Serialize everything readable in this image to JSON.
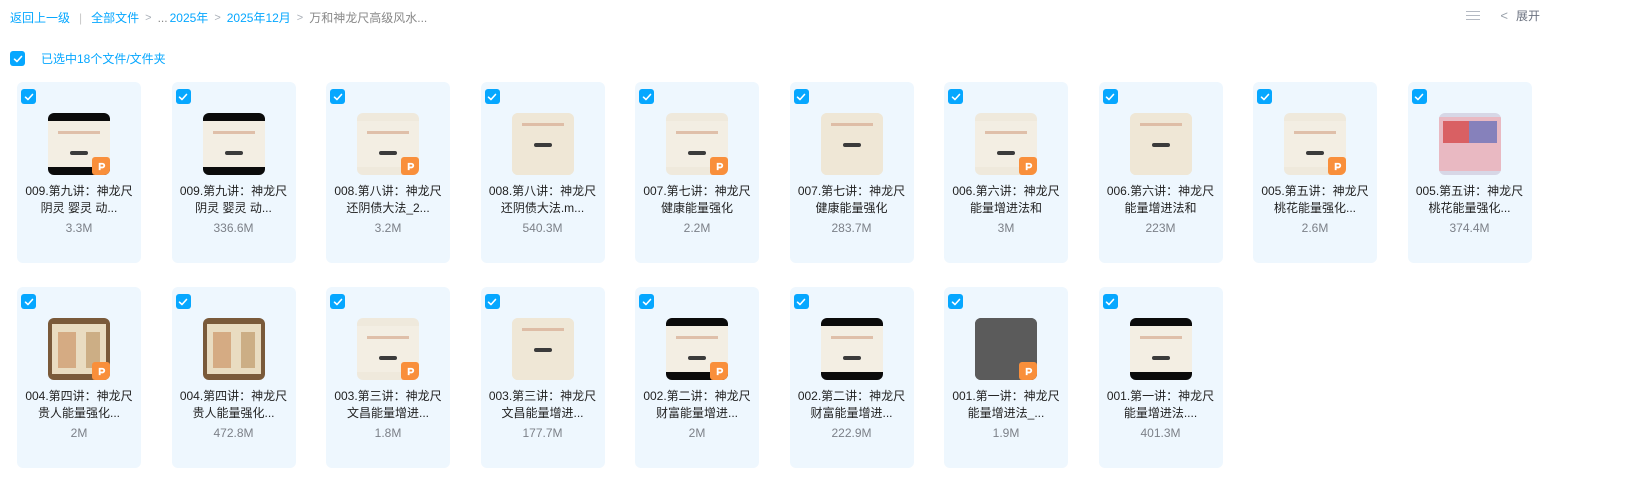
{
  "breadcrumb": {
    "back": "返回上一级",
    "separator": "|",
    "all_files": "全部文件",
    "arrow": ">",
    "ellipsis": "...",
    "year": "2025年",
    "month": "2025年12月",
    "current": "万和神龙尺高级风水..."
  },
  "toolbar": {
    "collapse_chevron": "<",
    "expand_label": "展开"
  },
  "selection": {
    "text": "已选中18个文件/文件夹"
  },
  "files": [
    {
      "name": "009.第九讲：神龙尺阴灵 婴灵 动...",
      "size": "3.3M",
      "ppt": true,
      "thumb": "dark"
    },
    {
      "name": "009.第九讲：神龙尺阴灵 婴灵 动...",
      "size": "336.6M",
      "ppt": false,
      "thumb": "dark"
    },
    {
      "name": "008.第八讲：神龙尺还阴债大法_2...",
      "size": "3.2M",
      "ppt": true,
      "thumb": "slide"
    },
    {
      "name": "008.第八讲：神龙尺还阴债大法.m...",
      "size": "540.3M",
      "ppt": false,
      "thumb": "cream"
    },
    {
      "name": "007.第七讲：神龙尺健康能量强化",
      "size": "2.2M",
      "ppt": true,
      "thumb": "slide"
    },
    {
      "name": "007.第七讲：神龙尺健康能量强化",
      "size": "283.7M",
      "ppt": false,
      "thumb": "cream"
    },
    {
      "name": "006.第六讲：神龙尺能量增进法和",
      "size": "3M",
      "ppt": true,
      "thumb": "slide"
    },
    {
      "name": "006.第六讲：神龙尺能量增进法和",
      "size": "223M",
      "ppt": false,
      "thumb": "cream"
    },
    {
      "name": "005.第五讲：神龙尺 桃花能量强化...",
      "size": "2.6M",
      "ppt": true,
      "thumb": "slide"
    },
    {
      "name": "005.第五讲：神龙尺 桃花能量强化...",
      "size": "374.4M",
      "ppt": false,
      "thumb": "collage"
    },
    {
      "name": "004.第四讲：神龙尺 贵人能量强化...",
      "size": "2M",
      "ppt": true,
      "thumb": "book"
    },
    {
      "name": "004.第四讲：神龙尺 贵人能量强化...",
      "size": "472.8M",
      "ppt": false,
      "thumb": "book"
    },
    {
      "name": "003.第三讲：神龙尺 文昌能量增进...",
      "size": "1.8M",
      "ppt": true,
      "thumb": "slide"
    },
    {
      "name": "003.第三讲：神龙尺 文昌能量增进...",
      "size": "177.7M",
      "ppt": false,
      "thumb": "cream"
    },
    {
      "name": "002.第二讲：神龙尺 财富能量增进...",
      "size": "2M",
      "ppt": true,
      "thumb": "dark"
    },
    {
      "name": "002.第二讲：神龙尺 财富能量增进...",
      "size": "222.9M",
      "ppt": false,
      "thumb": "dark"
    },
    {
      "name": "001.第一讲：神龙尺 能量增进法_...",
      "size": "1.9M",
      "ppt": true,
      "thumb": "gray"
    },
    {
      "name": "001.第一讲：神龙尺 能量增进法....",
      "size": "401.3M",
      "ppt": false,
      "thumb": "dark"
    }
  ],
  "colors": {
    "accent": "#06a7ff",
    "card_bg": "#eef7fe",
    "ppt_badge": "#f98f3b"
  },
  "icons": {
    "checkbox": "check-icon",
    "ppt": "ppt-file-icon",
    "list_view": "list-view-icon",
    "collapse": "chevron-left-icon"
  }
}
